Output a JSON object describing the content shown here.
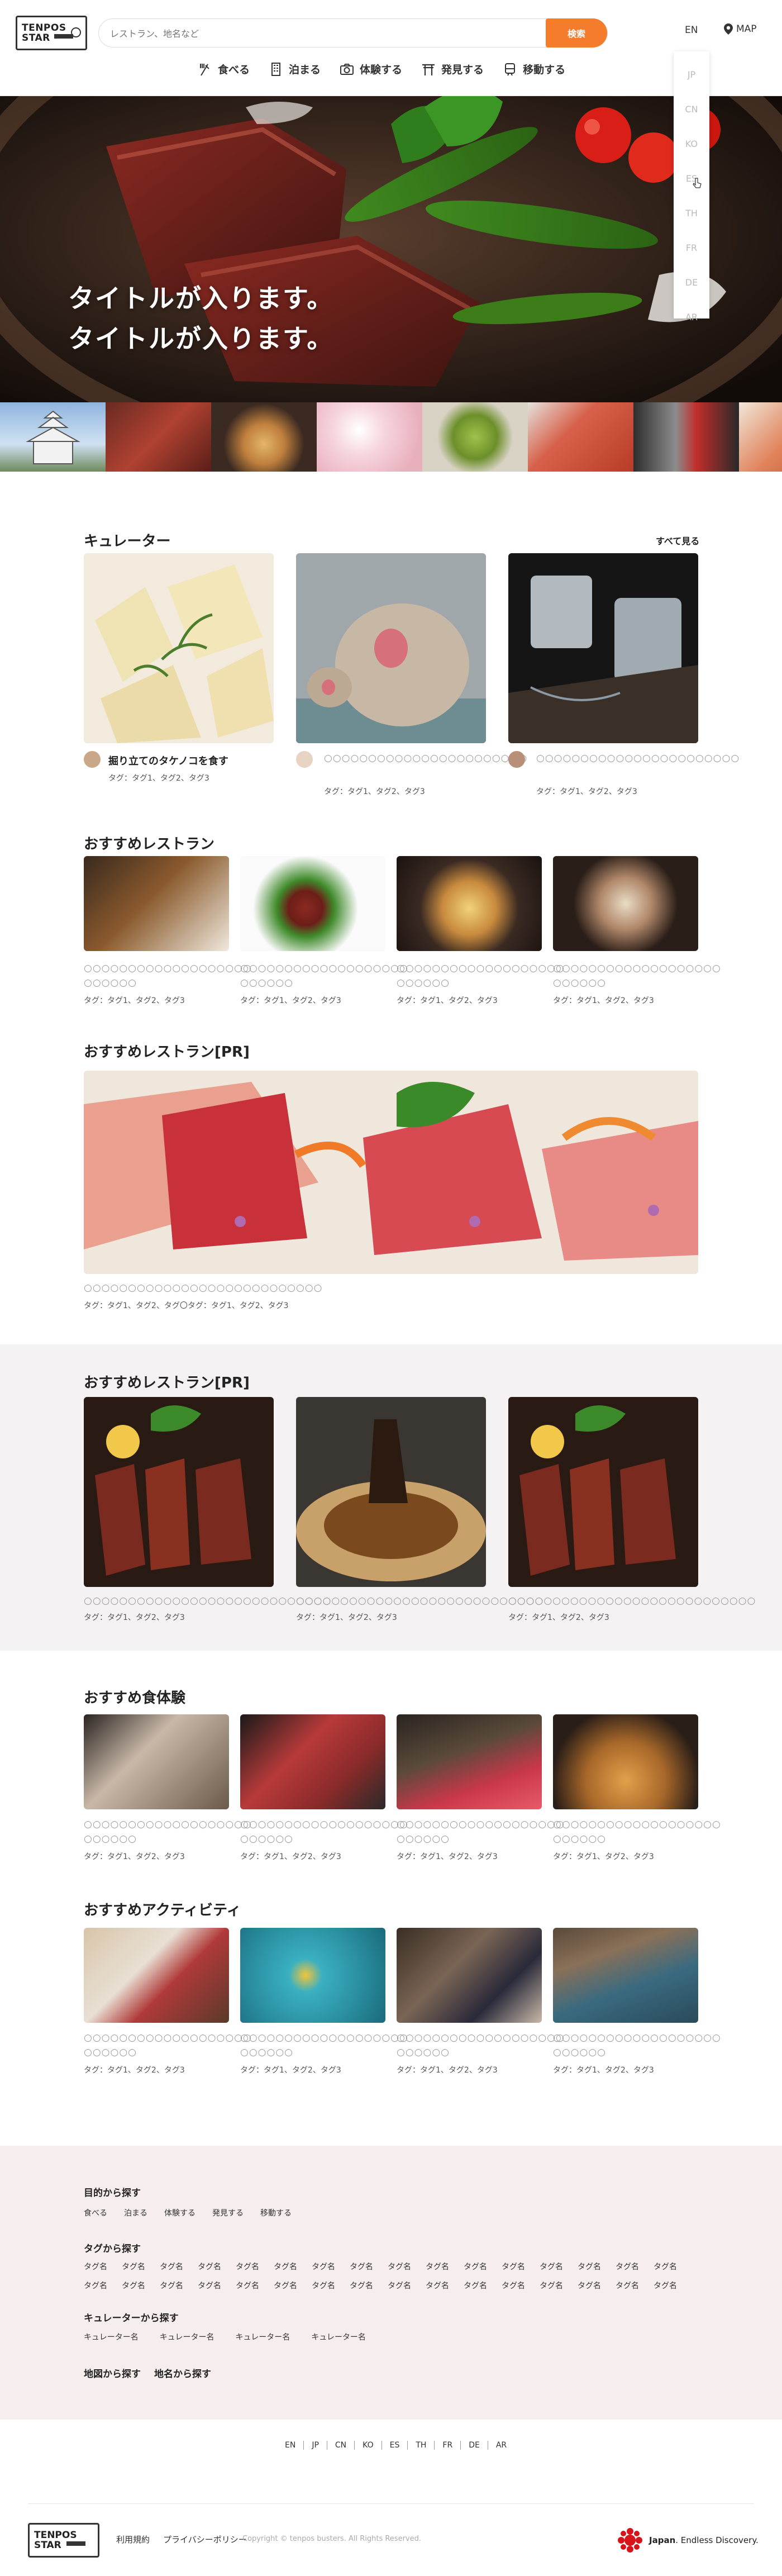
{
  "header": {
    "logo": "TENPOS STAR",
    "search_placeholder": "レストラン、地名など",
    "search_button": "検索",
    "lang_current": "EN",
    "map": "MAP"
  },
  "nav": [
    "食べる",
    "泊まる",
    "体験する",
    "発見する",
    "移動する"
  ],
  "lang_menu": [
    "JP",
    "CN",
    "KO",
    "ES",
    "TH",
    "FR",
    "DE",
    "AR"
  ],
  "hero": {
    "line1": "タイトルが入ります。",
    "line2": "タイトルが入ります。"
  },
  "curator": {
    "title": "キュレーター",
    "see_all": "すべて見る",
    "items": [
      {
        "title": "掘り立てのタケノコを食す",
        "tags": "タグ：タグ1、タグ2、タグ3"
      },
      {
        "title": "○○○○○○○○○○○○○○○○○○○○○○○",
        "tags": "タグ：タグ1、タグ2、タグ3"
      },
      {
        "title": "○○○○○○○○○○○○○○○○○○○○○○○",
        "tags": "タグ：タグ1、タグ2、タグ3"
      }
    ]
  },
  "restaurants": {
    "title": "おすすめレストラン",
    "items": [
      {
        "line1": "○○○○○○○○○○○○○○○○○○○",
        "line2": "○○○○○○",
        "tags": "タグ：タグ1、タグ2、タグ3"
      },
      {
        "line1": "○○○○○○○○○○○○○○○○○○○",
        "line2": "○○○○○○",
        "tags": "タグ：タグ1、タグ2、タグ3"
      },
      {
        "line1": "○○○○○○○○○○○○○○○○○○○",
        "line2": "○○○○○○",
        "tags": "タグ：タグ1、タグ2、タグ3"
      },
      {
        "line1": "○○○○○○○○○○○○○○○○○○○",
        "line2": "○○○○○○",
        "tags": "タグ：タグ1、タグ2、タグ3"
      }
    ]
  },
  "pr_wide": {
    "title": "おすすめレストラン[PR]",
    "line1": "○○○○○○○○○○○○○○○○○○○○○○○○○○○",
    "tags": "タグ：タグ1、タグ2、タグ〇タグ：タグ1、タグ2、タグ3"
  },
  "pr_three": {
    "title": "おすすめレストラン[PR]",
    "items": [
      {
        "line1": "○○○○○○○○○○○○○○○○○○○○○○○○○○○○",
        "tags": "タグ：タグ1、タグ2、タグ3"
      },
      {
        "line1": "○○○○○○○○○○○○○○○○○○○○○○○○○○○○",
        "tags": "タグ：タグ1、タグ2、タグ3"
      },
      {
        "line1": "○○○○○○○○○○○○○○○○○○○○○○○○○○○○",
        "tags": "タグ：タグ1、タグ2、タグ3"
      }
    ]
  },
  "experiences": {
    "title": "おすすめ食体験",
    "items": [
      {
        "line1": "○○○○○○○○○○○○○○○○○○○",
        "line2": "○○○○○○",
        "tags": "タグ：タグ1、タグ2、タグ3"
      },
      {
        "line1": "○○○○○○○○○○○○○○○○○○○",
        "line2": "○○○○○○",
        "tags": "タグ：タグ1、タグ2、タグ3"
      },
      {
        "line1": "○○○○○○○○○○○○○○○○○○○",
        "line2": "○○○○○○",
        "tags": "タグ：タグ1、タグ2、タグ3"
      },
      {
        "line1": "○○○○○○○○○○○○○○○○○○○",
        "line2": "○○○○○○",
        "tags": "タグ：タグ1、タグ2、タグ3"
      }
    ]
  },
  "activities": {
    "title": "おすすめアクティビティ",
    "items": [
      {
        "line1": "○○○○○○○○○○○○○○○○○○○",
        "line2": "○○○○○○",
        "tags": "タグ：タグ1、タグ2、タグ3"
      },
      {
        "line1": "○○○○○○○○○○○○○○○○○○○",
        "line2": "○○○○○○",
        "tags": "タグ：タグ1、タグ2、タグ3"
      },
      {
        "line1": "○○○○○○○○○○○○○○○○○○○",
        "line2": "○○○○○○",
        "tags": "タグ：タグ1、タグ2、タグ3"
      },
      {
        "line1": "○○○○○○○○○○○○○○○○○○○",
        "line2": "○○○○○○",
        "tags": "タグ：タグ1、タグ2、タグ3"
      }
    ]
  },
  "footer": {
    "purpose_title": "目的から探す",
    "purpose": [
      "食べる",
      "泊まる",
      "体験する",
      "発見する",
      "移動する"
    ],
    "tags_title": "タグから探す",
    "tags": [
      "タグ名",
      "タグ名",
      "タグ名",
      "タグ名",
      "タグ名",
      "タグ名",
      "タグ名",
      "タグ名",
      "タグ名",
      "タグ名",
      "タグ名",
      "タグ名",
      "タグ名",
      "タグ名",
      "タグ名",
      "タグ名",
      "タグ名",
      "タグ名",
      "タグ名",
      "タグ名",
      "タグ名",
      "タグ名",
      "タグ名",
      "タグ名",
      "タグ名",
      "タグ名",
      "タグ名",
      "タグ名",
      "タグ名",
      "タグ名",
      "タグ名",
      "タグ名"
    ],
    "curator_title": "キュレーターから探す",
    "curators": [
      "キュレーター名",
      "キュレーター名",
      "キュレーター名",
      "キュレーター名"
    ],
    "map_search": "地図から探す",
    "place_search": "地名から探す",
    "langs": [
      "EN",
      "JP",
      "CN",
      "KO",
      "ES",
      "TH",
      "FR",
      "DE",
      "AR"
    ],
    "terms": "利用規約",
    "privacy": "プライバシーポリシー",
    "copyright": "Copyright © tenpos busters. All Rights Reserved.",
    "japan_brand": "Japan",
    "japan_tagline": ". Endless Discovery."
  },
  "colors": {
    "accent": "#f47c2b",
    "band": "#f4f2f2",
    "footer_bg": "#f6eeec"
  }
}
